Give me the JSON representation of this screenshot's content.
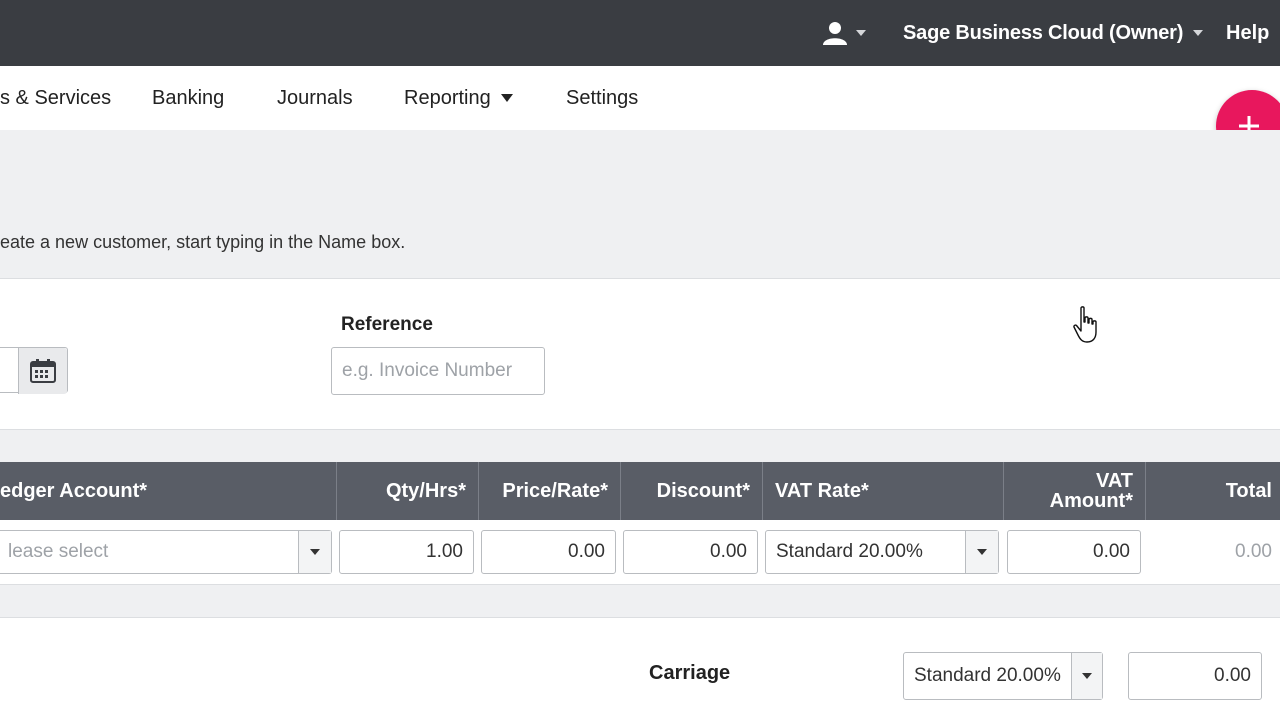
{
  "topbar": {
    "user_icon": "user-icon",
    "account_label": "Sage Business Cloud (Owner)",
    "help_label": "Help"
  },
  "nav": {
    "items": [
      {
        "label": "s & Services"
      },
      {
        "label": "Banking"
      },
      {
        "label": "Journals"
      },
      {
        "label": "Reporting"
      },
      {
        "label": "Settings"
      }
    ],
    "fab_icon": "plus-icon"
  },
  "banner": {
    "hint": "eate a new customer, start typing in the Name box."
  },
  "form": {
    "date_button_icon": "calendar-icon",
    "reference_label": "Reference",
    "reference_placeholder": "e.g. Invoice Number",
    "reference_value": ""
  },
  "table": {
    "headers": {
      "ledger": "edger Account*",
      "qty": "Qty/Hrs*",
      "price": "Price/Rate*",
      "discount": "Discount*",
      "vat_rate": "VAT Rate*",
      "vat_amount_line1": "VAT",
      "vat_amount_line2": "Amount*",
      "total": "Total"
    },
    "row": {
      "ledger_placeholder": "lease select",
      "qty": "1.00",
      "price": "0.00",
      "discount": "0.00",
      "vat_rate": "Standard 20.00%",
      "vat_amount": "0.00",
      "total": "0.00"
    }
  },
  "carriage": {
    "label": "Carriage",
    "vat_rate": "Standard 20.00%",
    "amount": "0.00"
  },
  "colors": {
    "topbar": "#3a3d42",
    "table_header": "#595d66",
    "fab": "#e8175d",
    "banner": "#eff0f2"
  }
}
